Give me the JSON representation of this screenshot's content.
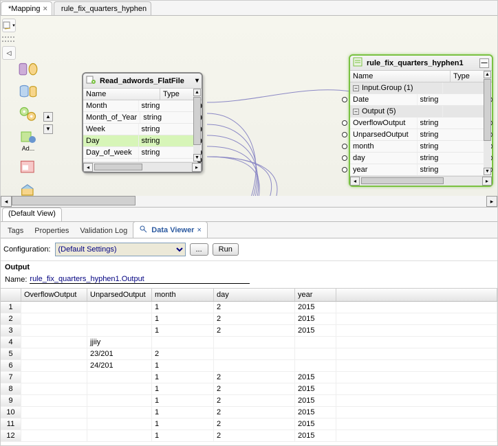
{
  "editor_tabs": [
    {
      "label": "*Mapping",
      "active": true,
      "closeable": true
    },
    {
      "label": "rule_fix_quarters_hyphen",
      "active": false,
      "closeable": false
    }
  ],
  "palette_ad_label": "Ad...",
  "source_node": {
    "title": "Read_adwords_FlatFile",
    "col_name": "Name",
    "col_type": "Type",
    "rows": [
      {
        "name": "Month",
        "type": "string"
      },
      {
        "name": "Month_of_Year",
        "type": "string"
      },
      {
        "name": "Week",
        "type": "string"
      },
      {
        "name": "Day",
        "type": "string",
        "highlight": true
      },
      {
        "name": "Day_of_week",
        "type": "string"
      },
      {
        "name": " ",
        "type": " "
      }
    ]
  },
  "target_node": {
    "title": "rule_fix_quarters_hyphen1",
    "col_name": "Name",
    "col_type": "Type",
    "groups": [
      {
        "label": "Input.Group (1)",
        "rows": [
          {
            "name": "Date",
            "type": "string"
          }
        ]
      },
      {
        "label": "Output (5)",
        "rows": [
          {
            "name": "OverflowOutput",
            "type": "string"
          },
          {
            "name": "UnparsedOutput",
            "type": "string"
          },
          {
            "name": "month",
            "type": "string"
          },
          {
            "name": "day",
            "type": "string"
          },
          {
            "name": "year",
            "type": "string"
          }
        ]
      }
    ]
  },
  "view_tab": "(Default View)",
  "bottom_tabs": [
    {
      "label": "Tags"
    },
    {
      "label": "Properties"
    },
    {
      "label": "Validation Log"
    },
    {
      "label": "Data Viewer",
      "active": true
    }
  ],
  "config": {
    "label": "Configuration:",
    "value": "(Default Settings)",
    "browse": "...",
    "run": "Run"
  },
  "output_header": "Output",
  "name_label": "Name:",
  "name_value": "rule_fix_quarters_hyphen1.Output",
  "grid_headers": [
    "OverflowOutput",
    "UnparsedOutput",
    "month",
    "day",
    "year"
  ],
  "chart_data": {
    "type": "table",
    "title": "rule_fix_quarters_hyphen1.Output",
    "columns": [
      "Row",
      "OverflowOutput",
      "UnparsedOutput",
      "month",
      "day",
      "year"
    ],
    "rows": [
      [
        1,
        "",
        "",
        "1",
        "2",
        "2015"
      ],
      [
        2,
        "",
        "",
        "1",
        "2",
        "2015"
      ],
      [
        3,
        "",
        "",
        "1",
        "2",
        "2015"
      ],
      [
        4,
        "",
        "jjiiy",
        "",
        "",
        ""
      ],
      [
        5,
        "",
        "23/201",
        "2",
        "",
        ""
      ],
      [
        6,
        "",
        "24/201",
        "1",
        "",
        ""
      ],
      [
        7,
        "",
        "",
        "1",
        "2",
        "2015"
      ],
      [
        8,
        "",
        "",
        "1",
        "2",
        "2015"
      ],
      [
        9,
        "",
        "",
        "1",
        "2",
        "2015"
      ],
      [
        10,
        "",
        "",
        "1",
        "2",
        "2015"
      ],
      [
        11,
        "",
        "",
        "1",
        "2",
        "2015"
      ],
      [
        12,
        "",
        "",
        "1",
        "2",
        "2015"
      ]
    ]
  }
}
